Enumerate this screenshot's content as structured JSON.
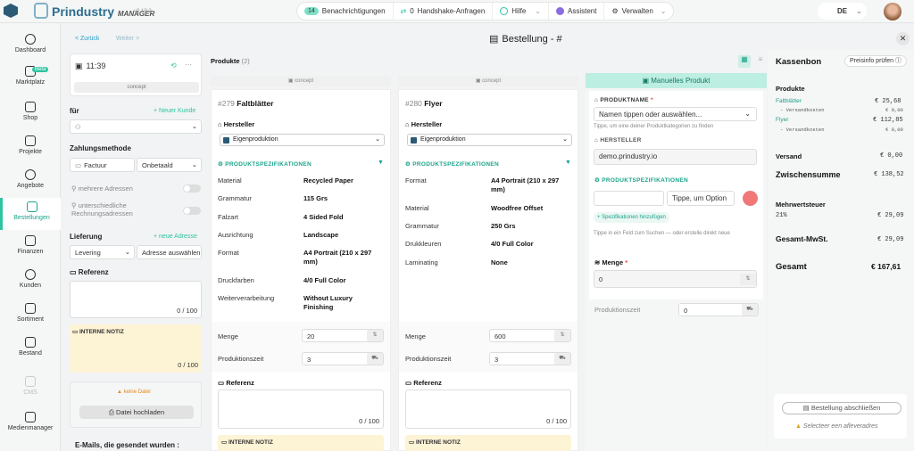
{
  "topbar": {
    "brand": "Prindustry",
    "brand_sub": "MANAGER",
    "version": "v3.19.2",
    "notif_count": "14",
    "notif_label": "Benachrichtigungen",
    "handshake_count": "0",
    "handshake_label": "Handshake-Anfragen",
    "help_label": "Hilfe",
    "assistant_label": "Assistent",
    "manage_label": "Verwalten",
    "lang": "DE"
  },
  "sidebar": {
    "items": [
      {
        "label": "Dashboard"
      },
      {
        "label": "Marktplatz",
        "badge": "Beta"
      },
      {
        "label": "Shop"
      },
      {
        "label": "Projekte"
      },
      {
        "label": "Angebote"
      },
      {
        "label": "Bestellungen"
      },
      {
        "label": "Finanzen"
      },
      {
        "label": "Kunden"
      },
      {
        "label": "Sortiment"
      },
      {
        "label": "Bestand"
      },
      {
        "label": "CMS"
      },
      {
        "label": "Medienmanager"
      }
    ]
  },
  "nav": {
    "back": "< Zurück",
    "forward": "Weiter >",
    "title": "Bestellung - #"
  },
  "left": {
    "time": "11:39",
    "status": "concept",
    "for_label": "für",
    "new_customer": "+ Neuer Kunde",
    "payment_label": "Zahlungsmethode",
    "payment_method": "Factuur",
    "payment_status": "Onbetaald",
    "multi_addr": "mehrere Adressen",
    "diff_addr": "unterschiedliche Rechnungsadressen",
    "delivery_label": "Lieferung",
    "new_address": "+ neue Adresse",
    "delivery_method": "Levering",
    "address_placeholder": "Adresse auswählen",
    "ref_label": "Referenz",
    "ref_count": "0 / 100",
    "note_label": "INTERNE NOTIZ",
    "note_count": "0 / 100",
    "no_file": "keine Datei",
    "upload": "Datei hochladen",
    "emails_label": "E-Mails, die gesendet wurden :"
  },
  "products": {
    "header": "Produkte",
    "count": "(2)",
    "items": [
      {
        "status": "concept",
        "id": "#279",
        "name": "Faltblätter",
        "manufacturer_label": "Hersteller",
        "manufacturer": "Eigenproduktion",
        "spec_label": "PRODUKTSPEZIFIKATIONEN",
        "specs": [
          [
            "Material",
            "Recycled Paper"
          ],
          [
            "Grammatur",
            "115 Grs"
          ],
          [
            "Falzart",
            "4 Sided Fold"
          ],
          [
            "Ausrichtung",
            "Landscape"
          ],
          [
            "Format",
            "A4 Portrait (210 x 297 mm)"
          ],
          [
            "Druckfarben",
            "4/0 Full Color"
          ],
          [
            "Weiterverarbeitung",
            "Without Luxury Finishing"
          ]
        ],
        "qty_label": "Menge",
        "qty": "20",
        "time_label": "Produktionszeit",
        "time": "3",
        "ref_label": "Referenz",
        "ref_count": "0 / 100",
        "note_label": "INTERNE NOTIZ"
      },
      {
        "status": "concept",
        "id": "#280",
        "name": "Flyer",
        "manufacturer_label": "Hersteller",
        "manufacturer": "Eigenproduktion",
        "spec_label": "PRODUKTSPEZIFIKATIONEN",
        "specs": [
          [
            "Format",
            "A4 Portrait (210 x 297 mm)"
          ],
          [
            "Material",
            "Woodfree Offset"
          ],
          [
            "Grammatur",
            "250 Grs"
          ],
          [
            "Drukkleuren",
            "4/0 Full Color"
          ],
          [
            "Laminating",
            "None"
          ]
        ],
        "qty_label": "Menge",
        "qty": "600",
        "time_label": "Produktionszeit",
        "time": "3",
        "ref_label": "Referenz",
        "ref_count": "0 / 100",
        "note_label": "INTERNE NOTIZ"
      }
    ]
  },
  "manual": {
    "header": "Manuelles Produkt",
    "name_label": "PRODUKTNAME",
    "name_placeholder": "Namen tippen oder auswählen...",
    "name_hint": "Tippe, um eine deiner Produktkategorien zu finden",
    "maker_label": "HERSTELLER",
    "maker": "demo.prindustry.io",
    "spec_label": "PRODUKTSPEZIFIKATIONEN",
    "spec_placeholder": "Tippe, um Option",
    "add_spec": "+ Spezifikationen hinzufügen",
    "spec_hint": "Tippe in ein Feld zum Suchen — oder erstelle direkt neue",
    "qty_label": "Menge",
    "qty": "0",
    "time_label": "Produktionszeit",
    "time": "0"
  },
  "receipt": {
    "title": "Kassenbon",
    "check": "Preisinfo prüfen",
    "products_label": "Produkte",
    "lines": [
      {
        "name": "Faltblätter",
        "price": "€ 25,68",
        "sub": "- Versandkosten",
        "sub_price": "€ 0,00"
      },
      {
        "name": "Flyer",
        "price": "€ 112,85",
        "sub": "- Versandkosten",
        "sub_price": "€ 0,00"
      }
    ],
    "shipping_label": "Versand",
    "shipping": "€ 0,00",
    "subtotal_label": "Zwischensumme",
    "subtotal": "€ 138,52",
    "vat_label": "Mehrwertsteuer",
    "vat_rate": "21%",
    "vat": "€ 29,09",
    "total_vat_label": "Gesamt-MwSt.",
    "total_vat": "€ 29,09",
    "total_label": "Gesamt",
    "total": "€ 167,61",
    "finish": "Bestellung abschließen",
    "warning": "Selecteer een afleveradres"
  }
}
